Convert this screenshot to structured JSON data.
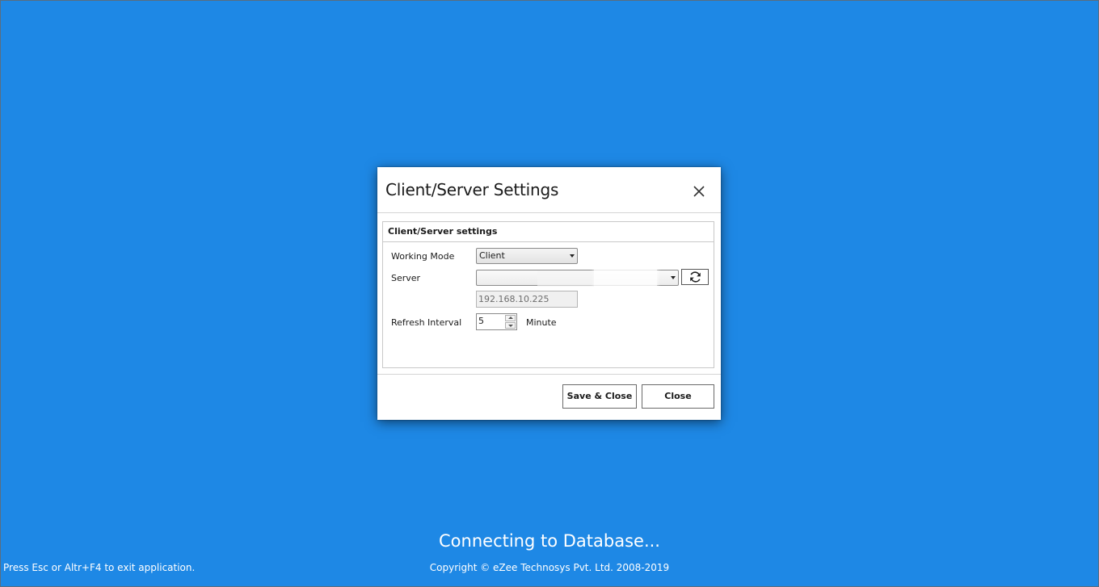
{
  "background": {
    "color": "#1e88e5",
    "status_text": "Connecting to Database...",
    "exit_hint": "Press Esc or Altr+F4 to exit application.",
    "copyright": "Copyright © eZee Technosys Pvt. Ltd. 2008-2019"
  },
  "dialog": {
    "title": "Client/Server Settings",
    "close_icon": "close-icon",
    "group_title": "Client/Server settings",
    "working_mode": {
      "label": "Working Mode",
      "value": "Client"
    },
    "server": {
      "label": "Server",
      "value": "",
      "ip_address": "192.168.10.225",
      "refresh_icon": "refresh-icon"
    },
    "refresh_interval": {
      "label": "Refresh Interval",
      "value": "5",
      "unit": "Minute"
    },
    "buttons": {
      "save_close": "Save & Close",
      "close": "Close"
    }
  }
}
